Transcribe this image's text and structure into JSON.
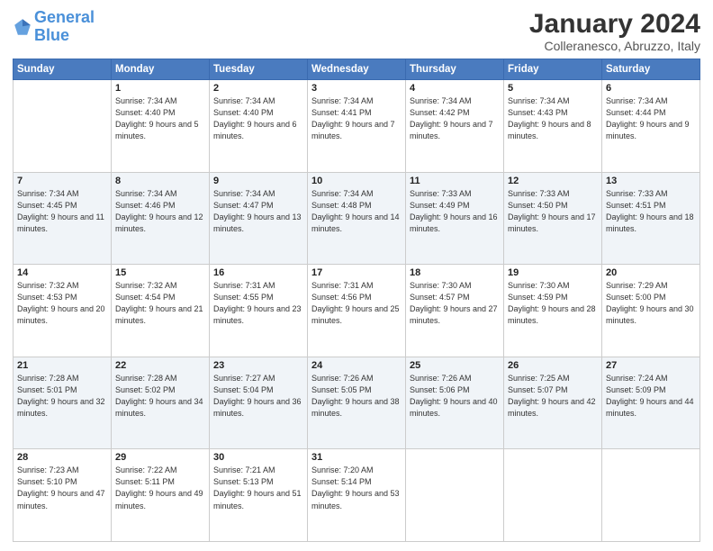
{
  "header": {
    "logo_text_general": "General",
    "logo_text_blue": "Blue",
    "month_title": "January 2024",
    "location": "Colleranesco, Abruzzo, Italy"
  },
  "days_of_week": [
    "Sunday",
    "Monday",
    "Tuesday",
    "Wednesday",
    "Thursday",
    "Friday",
    "Saturday"
  ],
  "weeks": [
    [
      {
        "day": "",
        "sunrise": "",
        "sunset": "",
        "daylight": ""
      },
      {
        "day": "1",
        "sunrise": "Sunrise: 7:34 AM",
        "sunset": "Sunset: 4:40 PM",
        "daylight": "Daylight: 9 hours and 5 minutes."
      },
      {
        "day": "2",
        "sunrise": "Sunrise: 7:34 AM",
        "sunset": "Sunset: 4:40 PM",
        "daylight": "Daylight: 9 hours and 6 minutes."
      },
      {
        "day": "3",
        "sunrise": "Sunrise: 7:34 AM",
        "sunset": "Sunset: 4:41 PM",
        "daylight": "Daylight: 9 hours and 7 minutes."
      },
      {
        "day": "4",
        "sunrise": "Sunrise: 7:34 AM",
        "sunset": "Sunset: 4:42 PM",
        "daylight": "Daylight: 9 hours and 7 minutes."
      },
      {
        "day": "5",
        "sunrise": "Sunrise: 7:34 AM",
        "sunset": "Sunset: 4:43 PM",
        "daylight": "Daylight: 9 hours and 8 minutes."
      },
      {
        "day": "6",
        "sunrise": "Sunrise: 7:34 AM",
        "sunset": "Sunset: 4:44 PM",
        "daylight": "Daylight: 9 hours and 9 minutes."
      }
    ],
    [
      {
        "day": "7",
        "sunrise": "Sunrise: 7:34 AM",
        "sunset": "Sunset: 4:45 PM",
        "daylight": "Daylight: 9 hours and 11 minutes."
      },
      {
        "day": "8",
        "sunrise": "Sunrise: 7:34 AM",
        "sunset": "Sunset: 4:46 PM",
        "daylight": "Daylight: 9 hours and 12 minutes."
      },
      {
        "day": "9",
        "sunrise": "Sunrise: 7:34 AM",
        "sunset": "Sunset: 4:47 PM",
        "daylight": "Daylight: 9 hours and 13 minutes."
      },
      {
        "day": "10",
        "sunrise": "Sunrise: 7:34 AM",
        "sunset": "Sunset: 4:48 PM",
        "daylight": "Daylight: 9 hours and 14 minutes."
      },
      {
        "day": "11",
        "sunrise": "Sunrise: 7:33 AM",
        "sunset": "Sunset: 4:49 PM",
        "daylight": "Daylight: 9 hours and 16 minutes."
      },
      {
        "day": "12",
        "sunrise": "Sunrise: 7:33 AM",
        "sunset": "Sunset: 4:50 PM",
        "daylight": "Daylight: 9 hours and 17 minutes."
      },
      {
        "day": "13",
        "sunrise": "Sunrise: 7:33 AM",
        "sunset": "Sunset: 4:51 PM",
        "daylight": "Daylight: 9 hours and 18 minutes."
      }
    ],
    [
      {
        "day": "14",
        "sunrise": "Sunrise: 7:32 AM",
        "sunset": "Sunset: 4:53 PM",
        "daylight": "Daylight: 9 hours and 20 minutes."
      },
      {
        "day": "15",
        "sunrise": "Sunrise: 7:32 AM",
        "sunset": "Sunset: 4:54 PM",
        "daylight": "Daylight: 9 hours and 21 minutes."
      },
      {
        "day": "16",
        "sunrise": "Sunrise: 7:31 AM",
        "sunset": "Sunset: 4:55 PM",
        "daylight": "Daylight: 9 hours and 23 minutes."
      },
      {
        "day": "17",
        "sunrise": "Sunrise: 7:31 AM",
        "sunset": "Sunset: 4:56 PM",
        "daylight": "Daylight: 9 hours and 25 minutes."
      },
      {
        "day": "18",
        "sunrise": "Sunrise: 7:30 AM",
        "sunset": "Sunset: 4:57 PM",
        "daylight": "Daylight: 9 hours and 27 minutes."
      },
      {
        "day": "19",
        "sunrise": "Sunrise: 7:30 AM",
        "sunset": "Sunset: 4:59 PM",
        "daylight": "Daylight: 9 hours and 28 minutes."
      },
      {
        "day": "20",
        "sunrise": "Sunrise: 7:29 AM",
        "sunset": "Sunset: 5:00 PM",
        "daylight": "Daylight: 9 hours and 30 minutes."
      }
    ],
    [
      {
        "day": "21",
        "sunrise": "Sunrise: 7:28 AM",
        "sunset": "Sunset: 5:01 PM",
        "daylight": "Daylight: 9 hours and 32 minutes."
      },
      {
        "day": "22",
        "sunrise": "Sunrise: 7:28 AM",
        "sunset": "Sunset: 5:02 PM",
        "daylight": "Daylight: 9 hours and 34 minutes."
      },
      {
        "day": "23",
        "sunrise": "Sunrise: 7:27 AM",
        "sunset": "Sunset: 5:04 PM",
        "daylight": "Daylight: 9 hours and 36 minutes."
      },
      {
        "day": "24",
        "sunrise": "Sunrise: 7:26 AM",
        "sunset": "Sunset: 5:05 PM",
        "daylight": "Daylight: 9 hours and 38 minutes."
      },
      {
        "day": "25",
        "sunrise": "Sunrise: 7:26 AM",
        "sunset": "Sunset: 5:06 PM",
        "daylight": "Daylight: 9 hours and 40 minutes."
      },
      {
        "day": "26",
        "sunrise": "Sunrise: 7:25 AM",
        "sunset": "Sunset: 5:07 PM",
        "daylight": "Daylight: 9 hours and 42 minutes."
      },
      {
        "day": "27",
        "sunrise": "Sunrise: 7:24 AM",
        "sunset": "Sunset: 5:09 PM",
        "daylight": "Daylight: 9 hours and 44 minutes."
      }
    ],
    [
      {
        "day": "28",
        "sunrise": "Sunrise: 7:23 AM",
        "sunset": "Sunset: 5:10 PM",
        "daylight": "Daylight: 9 hours and 47 minutes."
      },
      {
        "day": "29",
        "sunrise": "Sunrise: 7:22 AM",
        "sunset": "Sunset: 5:11 PM",
        "daylight": "Daylight: 9 hours and 49 minutes."
      },
      {
        "day": "30",
        "sunrise": "Sunrise: 7:21 AM",
        "sunset": "Sunset: 5:13 PM",
        "daylight": "Daylight: 9 hours and 51 minutes."
      },
      {
        "day": "31",
        "sunrise": "Sunrise: 7:20 AM",
        "sunset": "Sunset: 5:14 PM",
        "daylight": "Daylight: 9 hours and 53 minutes."
      },
      {
        "day": "",
        "sunrise": "",
        "sunset": "",
        "daylight": ""
      },
      {
        "day": "",
        "sunrise": "",
        "sunset": "",
        "daylight": ""
      },
      {
        "day": "",
        "sunrise": "",
        "sunset": "",
        "daylight": ""
      }
    ]
  ]
}
